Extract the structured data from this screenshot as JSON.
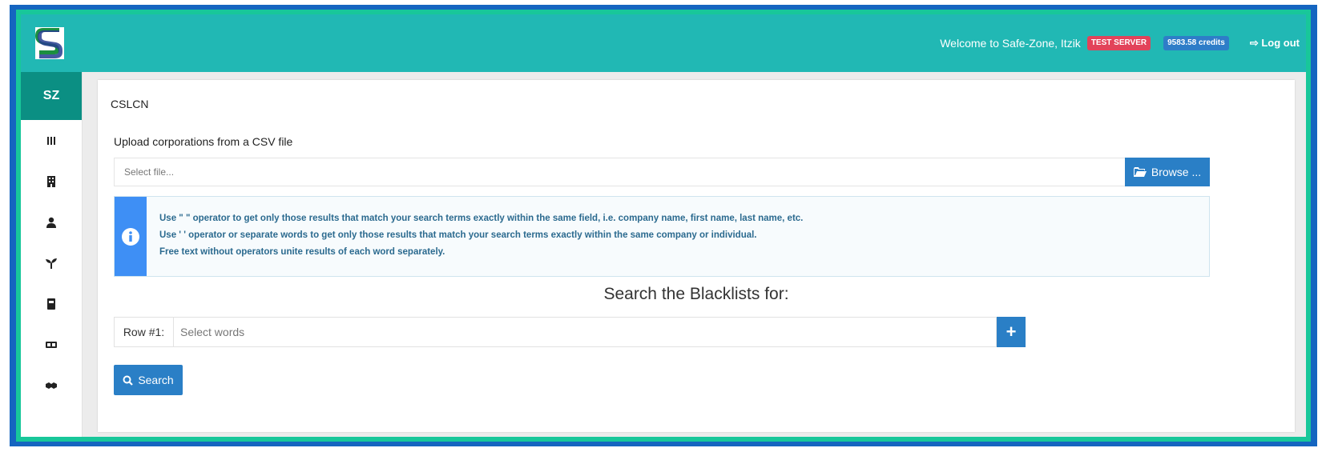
{
  "header": {
    "welcome": "Welcome to Safe-Zone, Itzik",
    "server_badge": "TEST SERVER",
    "credits_badge": "9583.58 credits",
    "logout_label": "Log out"
  },
  "sidebar": {
    "head": "SZ",
    "items": [
      {
        "icon": "columns-icon"
      },
      {
        "icon": "building-icon"
      },
      {
        "icon": "user-icon"
      },
      {
        "icon": "seedling-icon"
      },
      {
        "icon": "book-icon"
      },
      {
        "icon": "id-card-icon"
      },
      {
        "icon": "handshake-icon"
      }
    ]
  },
  "main": {
    "title": "CSLCN",
    "upload_label": "Upload corporations from a CSV file",
    "file_placeholder": "Select file...",
    "browse_label": "Browse ...",
    "info_lines": [
      "Use \" \" operator to get only those results that match your search terms exactly within the same field, i.e. company name, first name, last name, etc.",
      "Use ' ' operator or separate words to get only those results that match your search terms exactly within the same company or individual.",
      "Free text without operators unite results of each word separately."
    ],
    "search_heading": "Search the Blacklists for:",
    "row_label": "Row #1:",
    "words_placeholder": "Select words",
    "add_label": "+",
    "search_label": "Search"
  },
  "colors": {
    "topbar": "#21b8b4",
    "sidebar_head": "#0b8f83",
    "primary_button": "#2a7fc6",
    "test_badge": "#e2435a",
    "info_bar": "#3e8ff5"
  }
}
